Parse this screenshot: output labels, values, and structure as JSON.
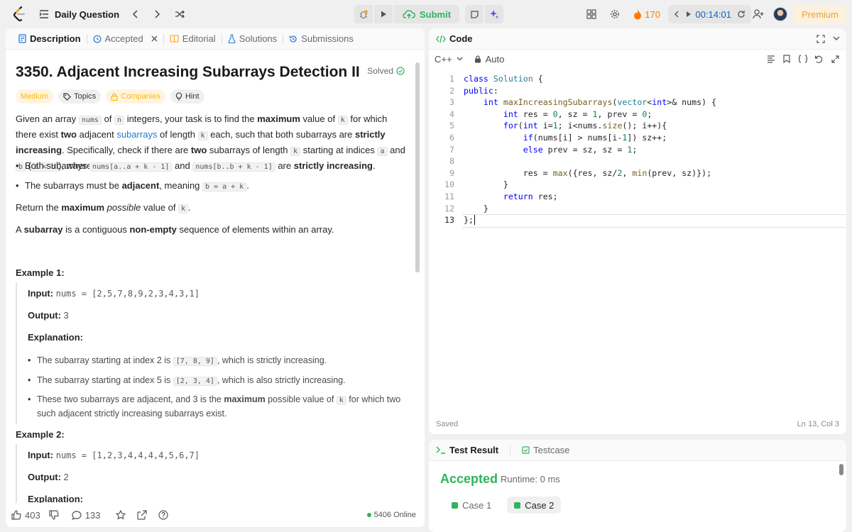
{
  "topbar": {
    "title": "Daily Question",
    "submit_label": "Submit",
    "streak": "170",
    "timer": "00:14:01",
    "premium": "Premium"
  },
  "left_tabs": [
    {
      "label": "Description"
    },
    {
      "label": "Accepted"
    },
    {
      "label": "Editorial"
    },
    {
      "label": "Solutions"
    },
    {
      "label": "Submissions"
    }
  ],
  "problem": {
    "title": "3350. Adjacent Increasing Subarrays Detection II",
    "status": "Solved",
    "chips": {
      "difficulty": "Medium",
      "topics": "Topics",
      "companies": "Companies",
      "hint": "Hint"
    },
    "p1": {
      "t1": "Given an array ",
      "c1": "nums",
      "t2": " of ",
      "c2": "n",
      "t3": " integers, your task is to find the ",
      "b1": "maximum",
      "t4": " value of ",
      "c3": "k",
      "t5": " for which there exist ",
      "b2": "two",
      "t6": " adjacent ",
      "link": "subarrays",
      "t7": " of length ",
      "c4": "k",
      "t8": " each, such that both subarrays are ",
      "b3": "strictly increasing",
      "t9": ". Specifically, check if there are ",
      "b4": "two",
      "t10": " subarrays of length ",
      "c5": "k",
      "t11": " starting at indices ",
      "c6": "a",
      "t12": " and ",
      "c7": "b",
      "t13": " (",
      "c8": "a < b",
      "t14": "), where:"
    },
    "bullet1": {
      "t1": "Both subarrays ",
      "c1": "nums[a..a + k - 1]",
      "t2": " and ",
      "c2": "nums[b..b + k - 1]",
      "t3": " are ",
      "b1": "strictly increasing",
      "t4": "."
    },
    "bullet2": {
      "t1": "The subarrays must be ",
      "b1": "adjacent",
      "t2": ", meaning ",
      "c1": "b = a + k",
      "t3": "."
    },
    "p2": {
      "t1": "Return the ",
      "b1": "maximum",
      "i1": "possible",
      "t2": " value of ",
      "c1": "k",
      "t3": "."
    },
    "p3": {
      "t1": "A ",
      "b1": "subarray",
      "t2": " is a contiguous ",
      "b2": "non-empty",
      "t3": " sequence of elements within an array."
    },
    "example1": {
      "head": "Example 1:",
      "input_label": "Input:",
      "input": "nums = [2,5,7,8,9,2,3,4,3,1]",
      "output_label": "Output:",
      "output": "3",
      "explanation_label": "Explanation:",
      "e1": {
        "t1": "The subarray starting at index 2 is ",
        "c1": "[7, 8, 9]",
        "t2": ", which is strictly increasing."
      },
      "e2": {
        "t1": "The subarray starting at index 5 is ",
        "c1": "[2, 3, 4]",
        "t2": ", which is also strictly increasing."
      },
      "e3": {
        "t1": "These two subarrays are adjacent, and 3 is the ",
        "b1": "maximum",
        "t2": " possible value of ",
        "c1": "k",
        "t3": " for which two such adjacent strictly increasing subarrays exist."
      }
    },
    "example2": {
      "head": "Example 2:",
      "input_label": "Input:",
      "input": "nums = [1,2,3,4,4,4,4,5,6,7]",
      "output_label": "Output:",
      "output": "2",
      "explanation_label": "Explanation:"
    }
  },
  "left_footer": {
    "likes": "403",
    "comments": "133",
    "online": "5406 Online"
  },
  "code_panel": {
    "title": "Code",
    "language": "C++",
    "mode": "Auto",
    "status_left": "Saved",
    "status_right": "Ln 13, Col 3"
  },
  "code_lines": [
    "class Solution {",
    "public:",
    "    int maxIncreasingSubarrays(vector<int>& nums) {",
    "        int res = 0, sz = 1, prev = 0;",
    "        for(int i=1; i<nums.size(); i++){",
    "            if(nums[i] > nums[i-1]) sz++;",
    "            else prev = sz, sz = 1;",
    "",
    "            res = max({res, sz/2, min(prev, sz)});",
    "        }",
    "        return res;",
    "    }",
    "};"
  ],
  "result_panel": {
    "tab_result": "Test Result",
    "tab_testcase": "Testcase",
    "verdict": "Accepted",
    "runtime": "Runtime: 0 ms",
    "case1": "Case 1",
    "case2": "Case 2"
  }
}
